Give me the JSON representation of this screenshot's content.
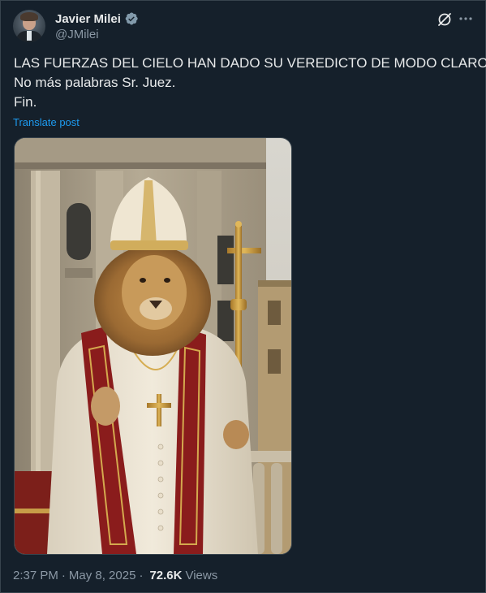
{
  "tweet": {
    "author": {
      "name": "Javier Milei",
      "handle": "@JMilei"
    },
    "text_lines": [
      "LAS FUERZAS DEL CIELO HAN DADO SU VEREDICTO DE MODO CLARO.",
      "No más palabras Sr. Juez.",
      "Fin."
    ],
    "translate_label": "Translate post",
    "meta": {
      "time": "2:37 PM",
      "separator": "·",
      "date": "May 8, 2025",
      "views_count": "72.6K",
      "views_label": "Views"
    }
  },
  "icons": {
    "verified": "verified-badge-icon",
    "grok": "grok-icon",
    "more": "more-options-icon"
  },
  "colors": {
    "background": "#15202b",
    "text": "#e7e9ea",
    "secondary_text": "#8b98a5",
    "accent": "#1d9bf0",
    "border": "#38444d"
  }
}
